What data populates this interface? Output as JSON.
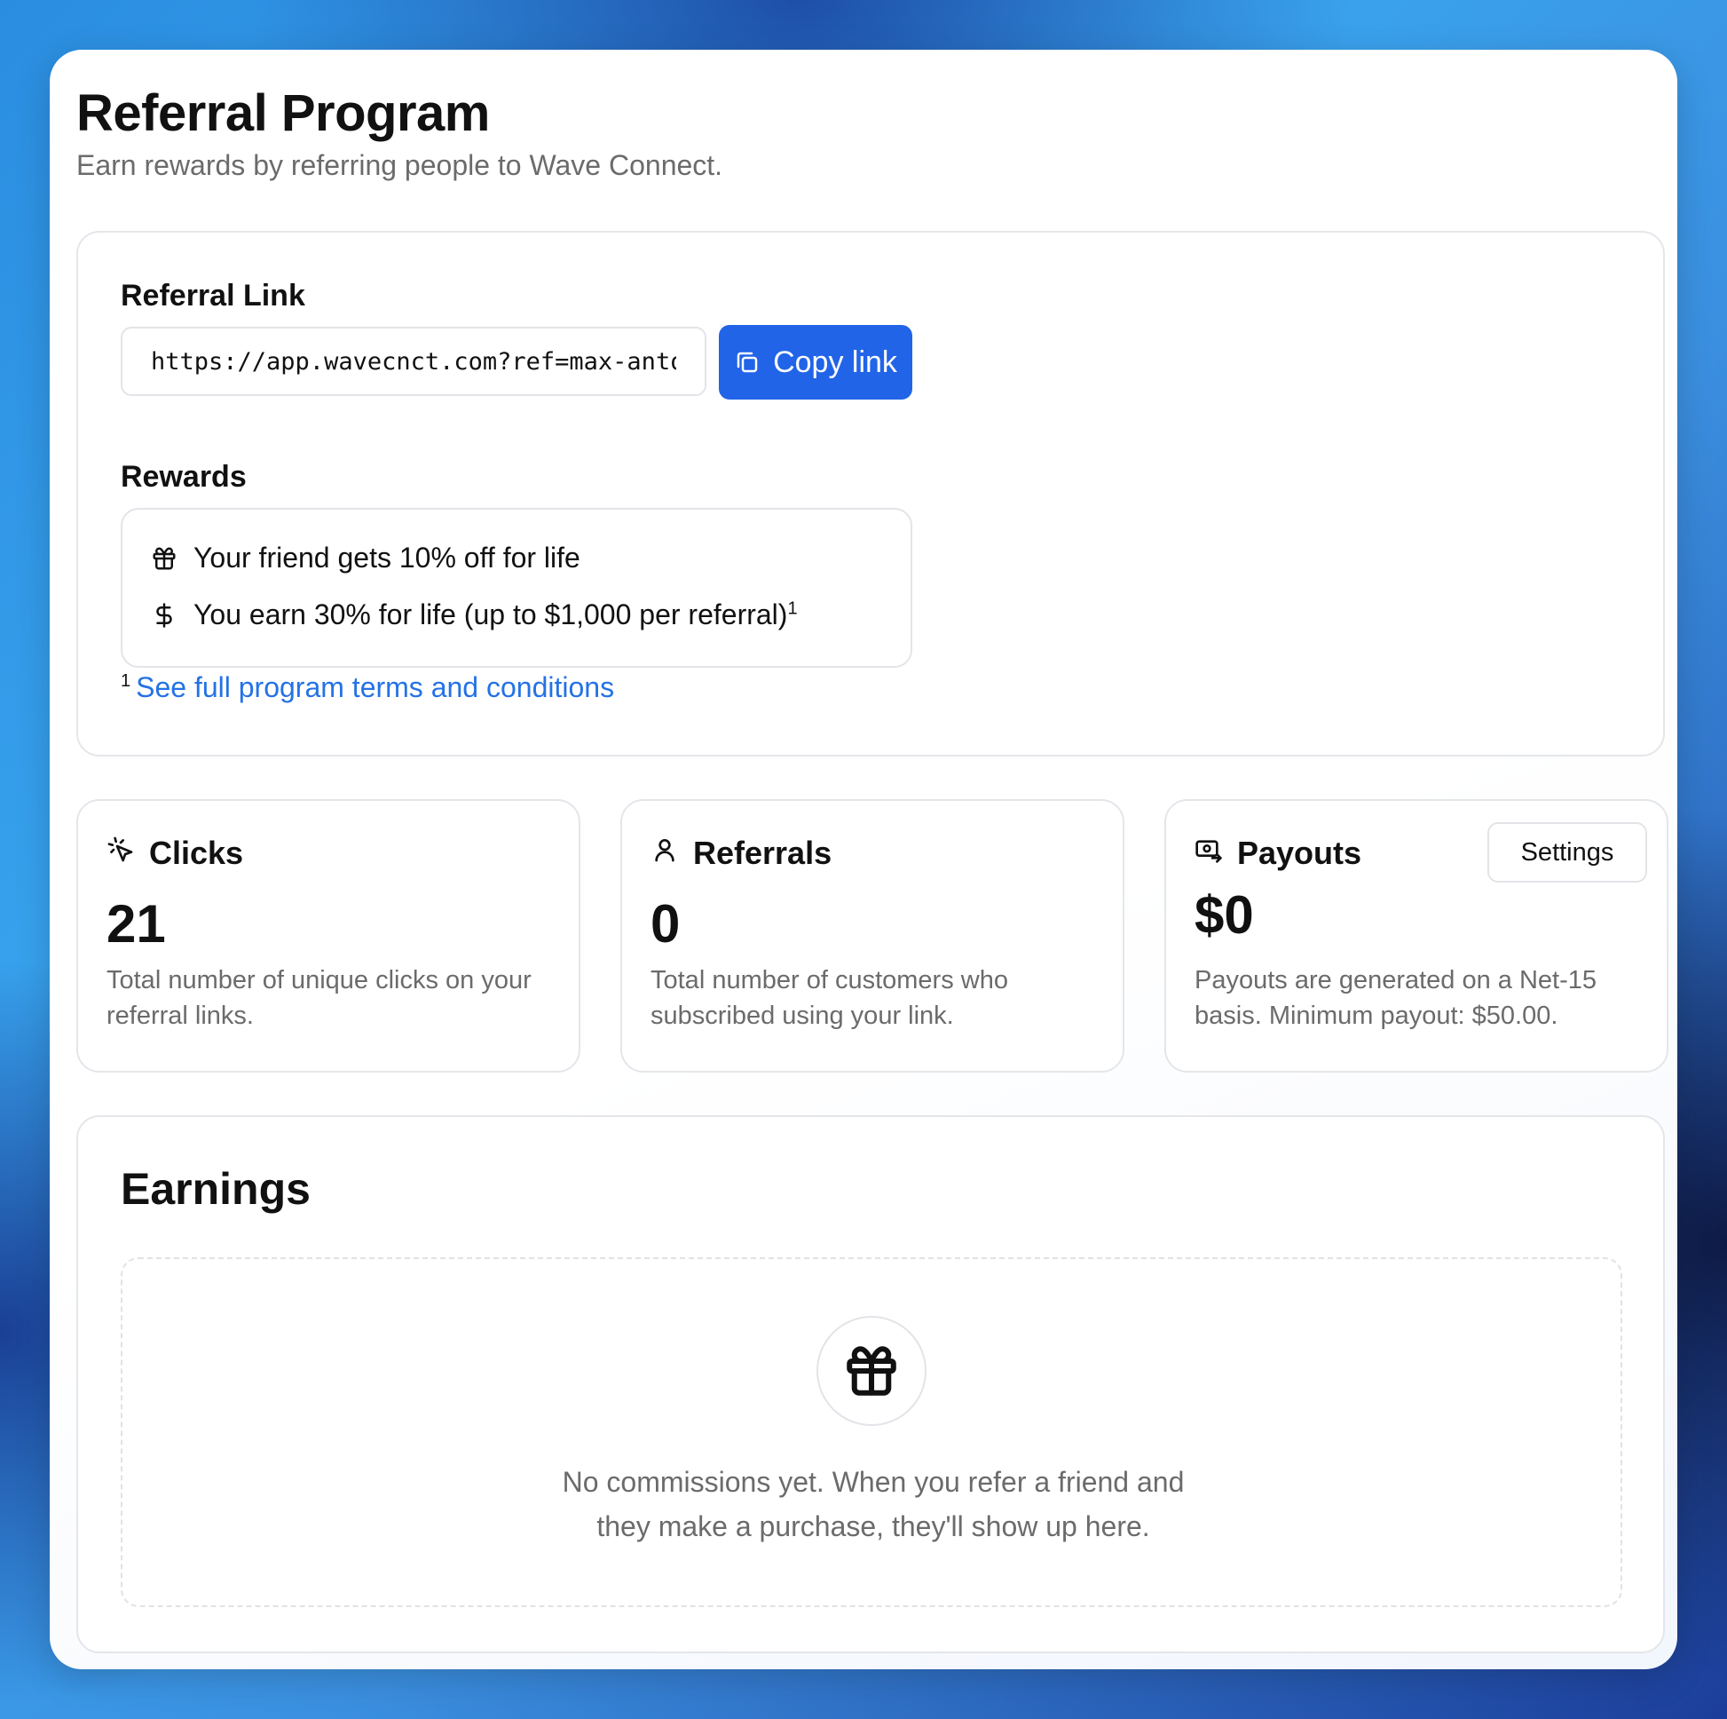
{
  "header": {
    "title": "Referral Program",
    "subtitle": "Earn rewards by referring people to Wave Connect."
  },
  "referral": {
    "link_label": "Referral Link",
    "link_value": "https://app.wavecnct.com?ref=max-anton",
    "copy_label": "Copy link",
    "rewards_label": "Rewards",
    "rewards": [
      {
        "icon": "gift-icon",
        "text": "Your friend gets 10% off for life",
        "footnote": ""
      },
      {
        "icon": "dollar-icon",
        "text": "You earn 30% for life (up to $1,000 per referral)",
        "footnote": "1"
      }
    ],
    "terms_footnote": "1",
    "terms_link": "See full program terms and conditions"
  },
  "stats": {
    "clicks": {
      "icon": "cursor-click-icon",
      "label": "Clicks",
      "value": "21",
      "description": "Total number of unique clicks on your referral links."
    },
    "referrals": {
      "icon": "user-icon",
      "label": "Referrals",
      "value": "0",
      "description": "Total number of customers who subscribed using your link."
    },
    "payouts": {
      "icon": "money-transfer-icon",
      "label": "Payouts",
      "value": "$0",
      "description": "Payouts are generated on a Net-15 basis. Minimum payout: $50.00.",
      "settings_label": "Settings"
    }
  },
  "earnings": {
    "title": "Earnings",
    "empty_icon": "gift-icon",
    "empty_line1": "No commissions yet. When you refer a friend and",
    "empty_line2": "they make a purchase, they'll show up here."
  },
  "colors": {
    "accent": "#2164e8",
    "link": "#2472e6",
    "muted_text": "#6b6b6b",
    "border": "#e4e6ea"
  }
}
